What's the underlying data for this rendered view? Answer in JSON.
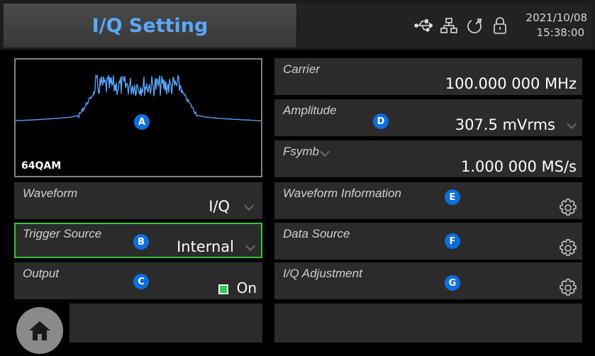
{
  "header": {
    "title": "I/Q Setting",
    "status_icons": [
      "usb-icon",
      "network-icon",
      "power-icon",
      "lock-icon"
    ],
    "date": "2021/10/08",
    "time": "15:38:00"
  },
  "preview": {
    "modulation": "64QAM",
    "badge": "A"
  },
  "left_panels": {
    "waveform": {
      "label": "Waveform",
      "value": "I/Q"
    },
    "trigger_source": {
      "label": "Trigger Source",
      "value": "Internal",
      "badge": "B"
    },
    "output": {
      "label": "Output",
      "value": "On",
      "badge": "C",
      "state_color": "#2bd24b"
    }
  },
  "right_panels": {
    "carrier": {
      "label": "Carrier",
      "value": "100.000 000 MHz"
    },
    "amplitude": {
      "label": "Amplitude",
      "value": "307.5 mVrms",
      "badge": "D"
    },
    "fsymb": {
      "label": "Fsymb",
      "value": "1.000 000 MS/s"
    },
    "waveform_info": {
      "label": "Waveform Information",
      "badge": "E"
    },
    "data_source": {
      "label": "Data Source",
      "badge": "F"
    },
    "iq_adjustment": {
      "label": "I/Q Adjustment",
      "badge": "G"
    }
  },
  "colors": {
    "accent_blue": "#5aa8ff",
    "badge_blue": "#0e6ee0",
    "focus_green": "#39c33c",
    "panel_bg": "#2b2b2b",
    "spectrum": "#5aa8ff"
  }
}
